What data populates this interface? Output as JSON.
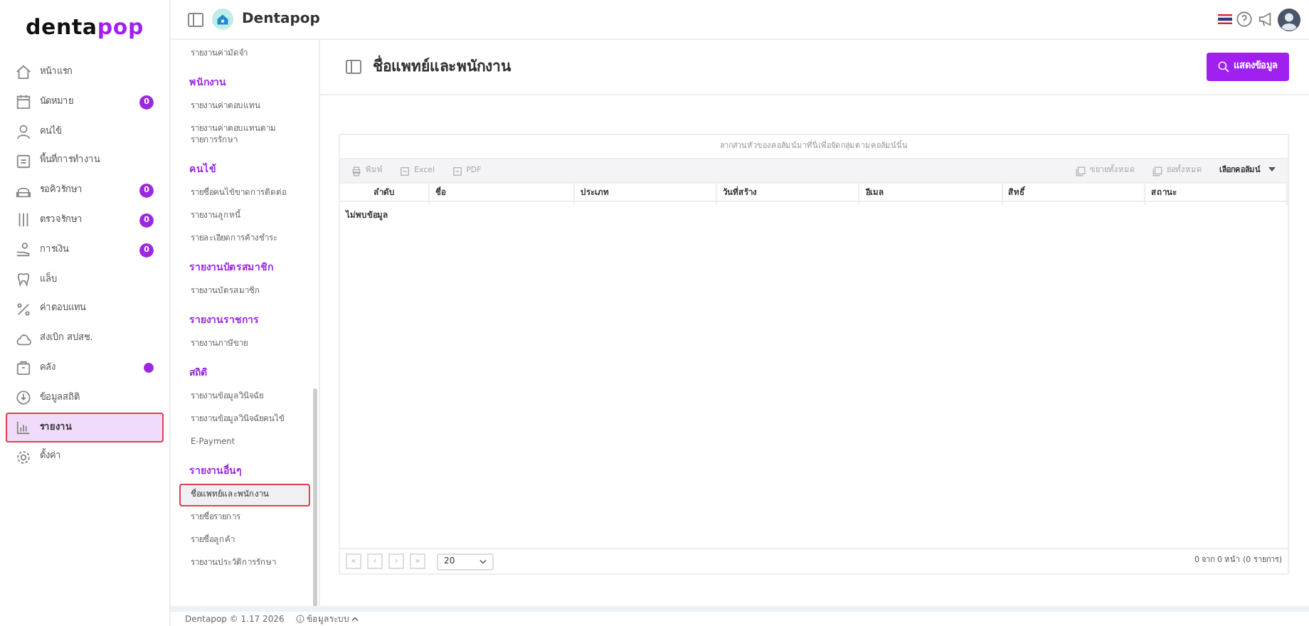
{
  "brand": {
    "logo_dark": "denta",
    "logo_accent": "pop"
  },
  "sidebar": {
    "items": [
      {
        "label": "หน้าแรก",
        "selected": false
      },
      {
        "label": "นัดหมาย",
        "selected": false,
        "badge": "0"
      },
      {
        "label": "คนไข้",
        "selected": false
      },
      {
        "label": "พื้นที่การทำงาน",
        "selected": false
      },
      {
        "label": "รอคิวรักษา",
        "selected": false,
        "badge": "0"
      },
      {
        "label": "ตรวจรักษา",
        "selected": false,
        "badge": "0"
      },
      {
        "label": "การเงิน",
        "selected": false,
        "badge": "0"
      },
      {
        "label": "แล็บ",
        "selected": false
      },
      {
        "label": "ค่าตอบแทน",
        "selected": false
      },
      {
        "label": "ส่งเบิก สปสช.",
        "selected": false
      },
      {
        "label": "คลัง",
        "selected": false,
        "notification": true
      },
      {
        "label": "ข้อมูลสถิติ",
        "selected": false
      },
      {
        "label": "รายงาน",
        "selected": true
      },
      {
        "label": "ตั้งค่า",
        "selected": false
      }
    ]
  },
  "topbar": {
    "clinic": "Dentapop"
  },
  "report_menu": {
    "sections": [
      {
        "items": [
          {
            "label": "รายงานค่ามัดจำ",
            "selected": false
          }
        ]
      },
      {
        "title": "พนักงาน",
        "items": [
          {
            "label": "รายงานค่าตอบแทน",
            "selected": false
          },
          {
            "label": "รายงานค่าตอบแทนตามรายการรักษา",
            "selected": false
          }
        ]
      },
      {
        "title": "คนไข้",
        "items": [
          {
            "label": "รายชื่อคนไข้ขาดการติดต่อ",
            "selected": false
          },
          {
            "label": "รายงานลูกหนี้",
            "selected": false
          },
          {
            "label": "รายละเอียดการค้างชำระ",
            "selected": false
          }
        ]
      },
      {
        "title": "รายงานบัตรสมาชิก",
        "items": [
          {
            "label": "รายงานบัตรสมาชิก",
            "selected": false
          }
        ]
      },
      {
        "title": "รายงานราชการ",
        "items": [
          {
            "label": "รายงานภาษีขาย",
            "selected": false
          }
        ]
      },
      {
        "title": "สถิติ",
        "items": [
          {
            "label": "รายงานข้อมูลวินิจฉัย",
            "selected": false
          },
          {
            "label": "รายงานข้อมูลวินิจฉัยคนไข้",
            "selected": false
          },
          {
            "label": "E-Payment",
            "selected": false
          }
        ]
      },
      {
        "title": "รายงานอื่นๆ",
        "items": [
          {
            "label": "ชื่อแพทย์และพนักงาน",
            "selected": true
          },
          {
            "label": "รายชื่อรายการ",
            "selected": false
          },
          {
            "label": "รายชื่อลูกค้า",
            "selected": false
          },
          {
            "label": "รายงานประวัติการรักษา",
            "selected": false
          }
        ]
      }
    ]
  },
  "footer": {
    "version": "Dentapop © 1.17 2026",
    "info": "ข้อมูลระบบ"
  },
  "page": {
    "title": "ชื่อแพทย์และพนักงาน",
    "show_button": "แสดงข้อมูล"
  },
  "grid": {
    "group_hint": "ลากส่วนหัวของคอลัมน์มาที่นี่เพื่อจัดกลุ่มตามคอลัมน์นั้น",
    "export_buttons": [
      "พิมพ์",
      "Excel",
      "PDF"
    ],
    "expand_all": "ขยายทั้งหมด",
    "collapse_all": "ย่อทั้งหมด",
    "column_chooser": "เลือกคอลัมน์",
    "columns": [
      "ลำดับ",
      "ชื่อ",
      "ประเภท",
      "วันที่สร้าง",
      "อีเมล",
      "สิทธิ์",
      "สถานะ"
    ],
    "empty_text": "ไม่พบข้อมูล",
    "pager_buttons": [
      "«",
      "‹",
      "›",
      "»"
    ],
    "page_size": "20",
    "page_info": "0 จาก 0 หน้า (0 รายการ)"
  }
}
